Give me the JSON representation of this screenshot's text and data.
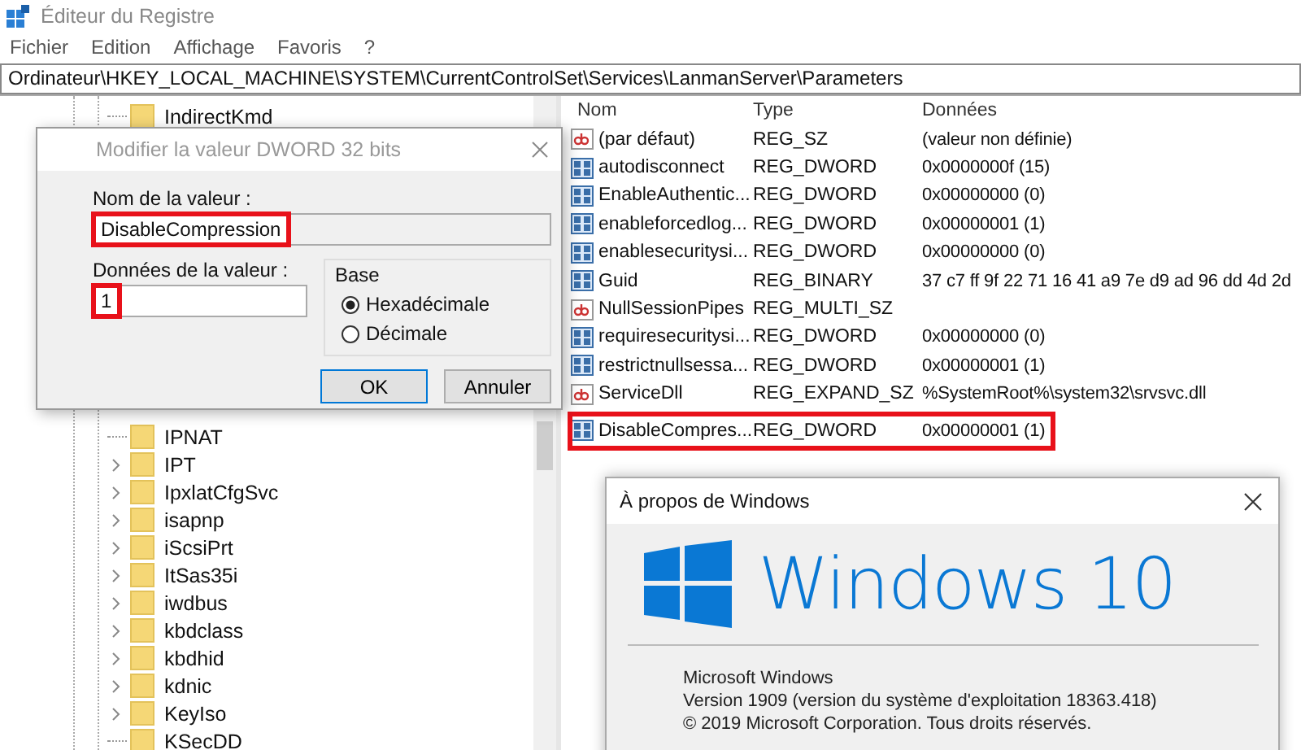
{
  "window": {
    "title": "Éditeur du Registre"
  },
  "menu": [
    "Fichier",
    "Edition",
    "Affichage",
    "Favoris",
    "?"
  ],
  "address": "Ordinateur\\HKEY_LOCAL_MACHINE\\SYSTEM\\CurrentControlSet\\Services\\LanmanServer\\Parameters",
  "tree": {
    "items_top": [
      {
        "label": "IndirectKmd",
        "has_children": false
      }
    ],
    "items": [
      {
        "label": "IPNAT",
        "has_children": false
      },
      {
        "label": "IPT",
        "has_children": true
      },
      {
        "label": "IpxlatCfgSvc",
        "has_children": true
      },
      {
        "label": "isapnp",
        "has_children": true
      },
      {
        "label": "iScsiPrt",
        "has_children": true
      },
      {
        "label": "ItSas35i",
        "has_children": true
      },
      {
        "label": "iwdbus",
        "has_children": true
      },
      {
        "label": "kbdclass",
        "has_children": true
      },
      {
        "label": "kbdhid",
        "has_children": true
      },
      {
        "label": "kdnic",
        "has_children": true
      },
      {
        "label": "KeyIso",
        "has_children": true
      },
      {
        "label": "KSecDD",
        "has_children": false
      }
    ]
  },
  "values": {
    "columns": [
      "Nom",
      "Type",
      "Données"
    ],
    "rows": [
      {
        "kind": "string",
        "name": "(par défaut)",
        "type": "REG_SZ",
        "data": "(valeur non définie)",
        "highlighted": false
      },
      {
        "kind": "binary",
        "name": "autodisconnect",
        "type": "REG_DWORD",
        "data": "0x0000000f (15)",
        "highlighted": false
      },
      {
        "kind": "binary",
        "name": "EnableAuthentic...",
        "type": "REG_DWORD",
        "data": "0x00000000 (0)",
        "highlighted": false
      },
      {
        "kind": "binary",
        "name": "enableforcedlog...",
        "type": "REG_DWORD",
        "data": "0x00000001 (1)",
        "highlighted": false
      },
      {
        "kind": "binary",
        "name": "enablesecuritysi...",
        "type": "REG_DWORD",
        "data": "0x00000000 (0)",
        "highlighted": false
      },
      {
        "kind": "binary",
        "name": "Guid",
        "type": "REG_BINARY",
        "data": "37 c7 ff 9f 22 71 16 41 a9 7e d9 ad 96 dd 4d 2d",
        "highlighted": false
      },
      {
        "kind": "string",
        "name": "NullSessionPipes",
        "type": "REG_MULTI_SZ",
        "data": "",
        "highlighted": false
      },
      {
        "kind": "binary",
        "name": "requiresecuritysi...",
        "type": "REG_DWORD",
        "data": "0x00000000 (0)",
        "highlighted": false
      },
      {
        "kind": "binary",
        "name": "restrictnullsessa...",
        "type": "REG_DWORD",
        "data": "0x00000001 (1)",
        "highlighted": false
      },
      {
        "kind": "string",
        "name": "ServiceDll",
        "type": "REG_EXPAND_SZ",
        "data": "%SystemRoot%\\system32\\srvsvc.dll",
        "highlighted": false
      },
      {
        "kind": "binary",
        "name": "DisableCompres...",
        "type": "REG_DWORD",
        "data": "0x00000001 (1)",
        "highlighted": true
      }
    ]
  },
  "edit_dialog": {
    "title": "Modifier la valeur DWORD 32 bits",
    "name_label": "Nom de la valeur :",
    "name_value": "DisableCompression",
    "name_highlighted": true,
    "data_label": "Données de la valeur :",
    "data_value": "1",
    "data_highlighted": true,
    "base_label": "Base",
    "bases": [
      {
        "label": "Hexadécimale",
        "selected": true
      },
      {
        "label": "Décimale",
        "selected": false
      }
    ],
    "buttons": [
      "OK",
      "Annuler"
    ]
  },
  "about_dialog": {
    "title": "À propos de Windows",
    "logo_text": "Windows 10",
    "lines": [
      "Microsoft Windows",
      "Version 1909 (version du système d'exploitation 18363.418)",
      "© 2019 Microsoft Corporation. Tous droits réservés."
    ]
  }
}
